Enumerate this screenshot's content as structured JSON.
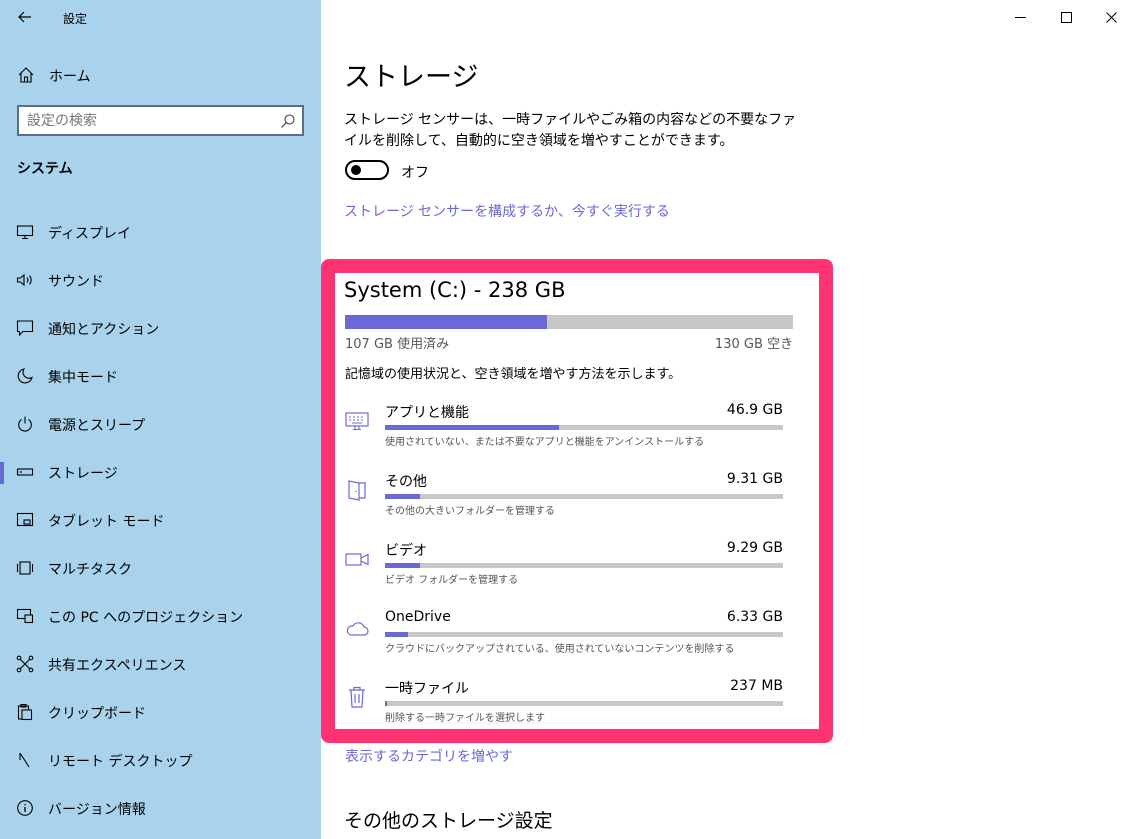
{
  "window": {
    "title": "設定"
  },
  "sidebar": {
    "home_label": "ホーム",
    "search_placeholder": "設定の検索",
    "section_title": "システム",
    "items": [
      {
        "label": "ディスプレイ",
        "icon": "display-icon"
      },
      {
        "label": "サウンド",
        "icon": "speaker-icon"
      },
      {
        "label": "通知とアクション",
        "icon": "notification-icon"
      },
      {
        "label": "集中モード",
        "icon": "moon-icon"
      },
      {
        "label": "電源とスリープ",
        "icon": "power-icon"
      },
      {
        "label": "ストレージ",
        "icon": "storage-icon",
        "active": true
      },
      {
        "label": "タブレット モード",
        "icon": "tablet-icon"
      },
      {
        "label": "マルチタスク",
        "icon": "multitask-icon"
      },
      {
        "label": "この PC へのプロジェクション",
        "icon": "projection-icon"
      },
      {
        "label": "共有エクスペリエンス",
        "icon": "share-icon"
      },
      {
        "label": "クリップボード",
        "icon": "clipboard-icon"
      },
      {
        "label": "リモート デスクトップ",
        "icon": "remote-desktop-icon"
      },
      {
        "label": "バージョン情報",
        "icon": "info-icon"
      }
    ]
  },
  "main": {
    "title": "ストレージ",
    "description": "ストレージ センサーは、一時ファイルやごみ箱の内容などの不要なファイルを削除して、自動的に空き領域を増やすことができます。",
    "toggle_label": "オフ",
    "toggle_on": false,
    "configure_link": "ストレージ センサーを構成するか、今すぐ実行する",
    "drive": {
      "title": "System (C:) - 238 GB",
      "used_label": "107 GB 使用済み",
      "free_label": "130 GB 空き",
      "used_fraction": 0.45,
      "categories_description": "記憶域の使用状況と、空き領域を増やす方法を示します。",
      "categories": [
        {
          "name": "アプリと機能",
          "size": "46.9 GB",
          "sub": "使用されていない、または不要なアプリと機能をアンインストールする",
          "fraction": 0.436,
          "icon": "apps-icon"
        },
        {
          "name": "その他",
          "size": "9.31 GB",
          "sub": "その他の大きいフォルダーを管理する",
          "fraction": 0.087,
          "icon": "other-folder-icon"
        },
        {
          "name": "ビデオ",
          "size": "9.29 GB",
          "sub": "ビデオ フォルダーを管理する",
          "fraction": 0.087,
          "icon": "video-icon"
        },
        {
          "name": "OneDrive",
          "size": "6.33 GB",
          "sub": "クラウドにバックアップされている、使用されていないコンテンツを削除する",
          "fraction": 0.059,
          "icon": "cloud-icon"
        },
        {
          "name": "一時ファイル",
          "size": "237 MB",
          "sub": "削除する一時ファイルを選択します",
          "fraction": 0.004,
          "icon": "trash-icon"
        }
      ]
    },
    "more_categories_link": "表示するカテゴリを増やす",
    "other_settings_title": "その他のストレージ設定"
  },
  "colors": {
    "sidebar_bg": "#a9d3ec",
    "accent": "#6b69d6",
    "highlight": "#ff3371",
    "bar_bg": "#c7c7c7"
  }
}
